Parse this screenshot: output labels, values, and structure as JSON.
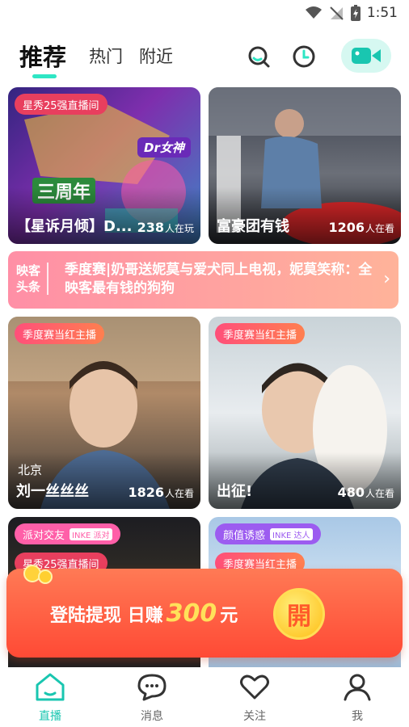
{
  "status_bar": {
    "time": "1:51"
  },
  "tabs": {
    "recommended": "推荐",
    "popular": "热门",
    "nearby": "附近"
  },
  "cards": [
    {
      "tag": "星秀25强直播间",
      "title": "【星诉月倾】D...",
      "count": "238",
      "count_unit": "人在玩",
      "poster_text": "Dr女神",
      "poster_text2": "三周年"
    },
    {
      "title": "富豪团有钱",
      "count": "1206",
      "count_unit": "人在看"
    },
    {
      "tag": "季度赛当红主播",
      "location": "北京",
      "title": "刘一丝丝丝",
      "count": "1826",
      "count_unit": "人在看"
    },
    {
      "tag": "季度赛当红主播",
      "title": "出征!",
      "count": "480",
      "count_unit": "人在看"
    },
    {
      "tag": "派对交友",
      "tag_badge": "INKE 派对",
      "tag2": "星秀25强直播间"
    },
    {
      "tag": "颜值诱惑",
      "tag_badge": "INKE 达人",
      "tag2": "季度赛当红主播"
    }
  ],
  "banner": {
    "logo": "映客头条",
    "text": "季度赛|奶哥送妮莫与爱犬同上电视，妮莫笑称：全映客最有钱的狗狗",
    "arrow": "›"
  },
  "promo": {
    "text_before": "登陆提现 日赚",
    "amount": "300",
    "text_after": "元",
    "coin_label": "開"
  },
  "bottom_nav": {
    "live": "直播",
    "messages": "消息",
    "follow": "关注",
    "me": "我"
  },
  "colors": {
    "accent": "#2ee6c4",
    "active_nav": "#19c6b0",
    "promo": "#ff4a35"
  }
}
